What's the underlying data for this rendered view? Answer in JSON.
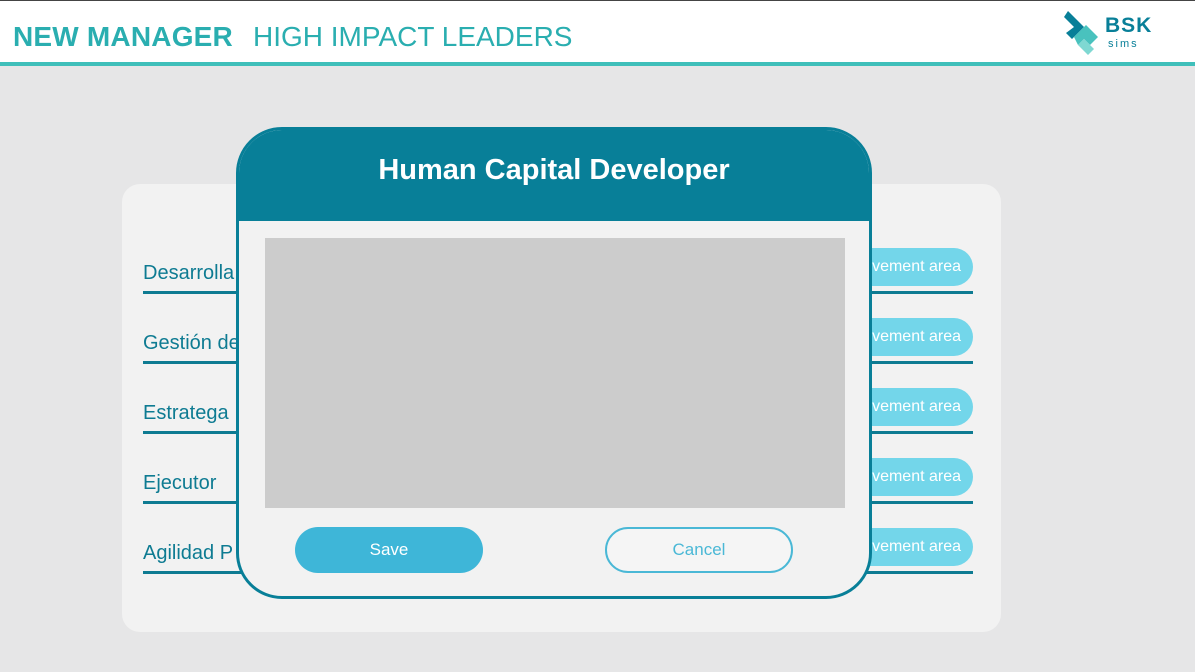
{
  "header": {
    "brand_primary": "NEW MANAGER",
    "brand_secondary": "HIGH IMPACT LEADERS",
    "logo_text": "BSK",
    "logo_sub": "sims",
    "accent_color": "#3fbfba"
  },
  "competencies": [
    {
      "label": "Desarrolla",
      "pill": "vement area"
    },
    {
      "label": "Gestión de",
      "pill": "vement area"
    },
    {
      "label": "Estratega",
      "pill": "vement area"
    },
    {
      "label": "Ejecutor",
      "pill": "vement area"
    },
    {
      "label": "Agilidad P",
      "pill": "vement area"
    }
  ],
  "modal": {
    "title": "Human Capital Developer",
    "text_value": "",
    "save_label": "Save",
    "cancel_label": "Cancel",
    "header_color": "#087f98"
  }
}
